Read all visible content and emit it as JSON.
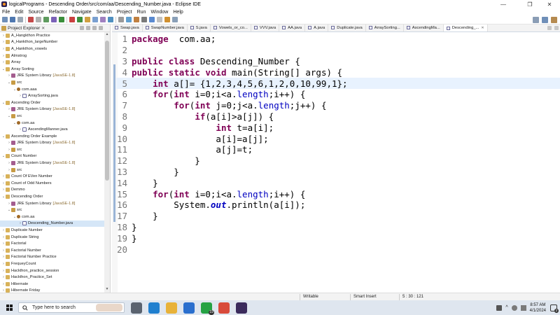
{
  "window": {
    "title": "logicalPrograms - Descending Order/src/com/aa/Descending_Number.java - Eclipse IDE",
    "controls": [
      "—",
      "❐",
      "✕"
    ]
  },
  "menu": [
    "File",
    "Edit",
    "Source",
    "Refactor",
    "Navigate",
    "Search",
    "Project",
    "Run",
    "Window",
    "Help"
  ],
  "toolbar": {
    "colors": [
      "#6f8fb8",
      "#4f78b0",
      "#9aa7b5",
      "#c44848",
      "#b0b0b0",
      "#5e9b5e",
      "#7b62b8",
      "#3a8f3a",
      "#ca4040",
      "#3d8f3d",
      "#d0a040",
      "#7aa0d0",
      "#a080c0",
      "#5090c0",
      "#9a9a9a",
      "#60a0d0",
      "#c08040",
      "#7a7a7a",
      "#5a8ad0",
      "#c0c0c0",
      "#d09030",
      "#8aa0b8"
    ]
  },
  "explorer": {
    "title": "Project Explorer",
    "close": "✕",
    "items": [
      {
        "indent": 0,
        "arrow": "›",
        "icon": "project",
        "label": "A_Hangkthon Practice"
      },
      {
        "indent": 0,
        "arrow": "›",
        "icon": "project",
        "label": "A_Hankthon_largeNumber"
      },
      {
        "indent": 0,
        "arrow": "›",
        "icon": "project",
        "label": "A_Hankthon_vowels"
      },
      {
        "indent": 0,
        "arrow": "›",
        "icon": "project",
        "label": "Almstrog"
      },
      {
        "indent": 0,
        "arrow": "›",
        "icon": "project",
        "label": "Array"
      },
      {
        "indent": 0,
        "arrow": "⌄",
        "icon": "project",
        "label": "Array Sorting"
      },
      {
        "indent": 1,
        "arrow": "›",
        "icon": "library",
        "label": "JRE System Library",
        "jre": "[JavaSE-1.8]"
      },
      {
        "indent": 1,
        "arrow": "⌄",
        "icon": "src",
        "label": "src"
      },
      {
        "indent": 2,
        "arrow": "⌄",
        "icon": "package",
        "label": "com.aaa"
      },
      {
        "indent": 3,
        "arrow": "›",
        "icon": "java",
        "label": "ArraySorting.java"
      },
      {
        "indent": 0,
        "arrow": "⌄",
        "icon": "project",
        "label": "Ascending Order"
      },
      {
        "indent": 1,
        "arrow": "›",
        "icon": "library",
        "label": "JRE System Library",
        "jre": "[JavaSE-1.8]"
      },
      {
        "indent": 1,
        "arrow": "⌄",
        "icon": "src",
        "label": "src"
      },
      {
        "indent": 2,
        "arrow": "⌄",
        "icon": "package",
        "label": "com.aa"
      },
      {
        "indent": 3,
        "arrow": "›",
        "icon": "java",
        "label": "AscendingManner.java"
      },
      {
        "indent": 0,
        "arrow": "⌄",
        "icon": "project",
        "label": "Ascending Order Example"
      },
      {
        "indent": 1,
        "arrow": "›",
        "icon": "library",
        "label": "JRE System Library",
        "jre": "[JavaSE-1.8]"
      },
      {
        "indent": 1,
        "arrow": "›",
        "icon": "src",
        "label": "src"
      },
      {
        "indent": 0,
        "arrow": "⌄",
        "icon": "project",
        "label": "Count Number"
      },
      {
        "indent": 1,
        "arrow": "›",
        "icon": "library",
        "label": "JRE System Library",
        "jre": "[JavaSE-1.8]"
      },
      {
        "indent": 1,
        "arrow": "›",
        "icon": "src",
        "label": "src"
      },
      {
        "indent": 0,
        "arrow": "›",
        "icon": "project",
        "label": "Count Of EVen Number"
      },
      {
        "indent": 0,
        "arrow": "›",
        "icon": "project",
        "label": "Count of Odd Numbers"
      },
      {
        "indent": 0,
        "arrow": "›",
        "icon": "project",
        "label": "Demmo"
      },
      {
        "indent": 0,
        "arrow": "⌄",
        "icon": "project",
        "label": "Descending Order"
      },
      {
        "indent": 1,
        "arrow": "›",
        "icon": "library",
        "label": "JRE System Library",
        "jre": "[JavaSE-1.8]"
      },
      {
        "indent": 1,
        "arrow": "⌄",
        "icon": "src",
        "label": "src"
      },
      {
        "indent": 2,
        "arrow": "⌄",
        "icon": "package",
        "label": "com.aa"
      },
      {
        "indent": 3,
        "arrow": "›",
        "icon": "java",
        "label": "Descending_Number.java",
        "selected": true
      },
      {
        "indent": 0,
        "arrow": "›",
        "icon": "project",
        "label": "Duplicate Number"
      },
      {
        "indent": 0,
        "arrow": "›",
        "icon": "project",
        "label": "Duplicate String"
      },
      {
        "indent": 0,
        "arrow": "›",
        "icon": "project",
        "label": "Factorial"
      },
      {
        "indent": 0,
        "arrow": "›",
        "icon": "project",
        "label": "Factorial Number"
      },
      {
        "indent": 0,
        "arrow": "›",
        "icon": "project",
        "label": "Factorial Number Practice"
      },
      {
        "indent": 0,
        "arrow": "›",
        "icon": "project",
        "label": "FrequeyCount"
      },
      {
        "indent": 0,
        "arrow": "›",
        "icon": "project",
        "label": "Hackthon_practice_session"
      },
      {
        "indent": 0,
        "arrow": "›",
        "icon": "project",
        "label": "Hackthon_Practice_Set"
      },
      {
        "indent": 0,
        "arrow": "›",
        "icon": "project",
        "label": "Hibernate"
      },
      {
        "indent": 0,
        "arrow": "›",
        "icon": "project",
        "label": "Hibernate Friday"
      }
    ]
  },
  "tabs": [
    {
      "label": "Swap.java"
    },
    {
      "label": "SwapNumber.java"
    },
    {
      "label": "S.java"
    },
    {
      "label": "Vowels_or_co..."
    },
    {
      "label": "VVV.java"
    },
    {
      "label": "AA.java"
    },
    {
      "label": "A.java"
    },
    {
      "label": "Duplicate.java"
    },
    {
      "label": "ArraySorting..."
    },
    {
      "label": "AscendingMa..."
    },
    {
      "label": "Descending_...",
      "active": true,
      "close": "✕"
    }
  ],
  "code": {
    "current_line": 5,
    "lines": [
      {
        "n": "1",
        "tokens": [
          [
            "kw",
            "package"
          ],
          [
            "",
            "  com.aa;"
          ]
        ]
      },
      {
        "n": "2",
        "tokens": []
      },
      {
        "n": "3",
        "tokens": [
          [
            "kw",
            "public"
          ],
          [
            "",
            " "
          ],
          [
            "kw",
            "class"
          ],
          [
            "",
            " Descending_Number {"
          ]
        ]
      },
      {
        "n": "4",
        "tokens": [
          [
            "kw",
            "public"
          ],
          [
            "",
            " "
          ],
          [
            "kw",
            "static"
          ],
          [
            "",
            " "
          ],
          [
            "kw",
            "void"
          ],
          [
            "",
            " main(String[] args) {"
          ]
        ]
      },
      {
        "n": "5",
        "tokens": [
          [
            "",
            "    "
          ],
          [
            "kw",
            "int"
          ],
          [
            "",
            " a[]= {1,2,3,4,5,6,1,2,0,10,99,1};"
          ]
        ]
      },
      {
        "n": "6",
        "tokens": [
          [
            "",
            "    "
          ],
          [
            "kw",
            "for"
          ],
          [
            "",
            "("
          ],
          [
            "kw",
            "int"
          ],
          [
            "",
            " i=0;i<a."
          ],
          [
            "fld",
            "length"
          ],
          [
            "",
            ";i++) {"
          ]
        ]
      },
      {
        "n": "7",
        "tokens": [
          [
            "",
            "        "
          ],
          [
            "kw",
            "for"
          ],
          [
            "",
            "("
          ],
          [
            "kw",
            "int"
          ],
          [
            "",
            " j=0;j<a."
          ],
          [
            "fld",
            "length"
          ],
          [
            "",
            ";j++) {"
          ]
        ]
      },
      {
        "n": "8",
        "tokens": [
          [
            "",
            "            "
          ],
          [
            "kw",
            "if"
          ],
          [
            "",
            "(a[i]>a[j]) {"
          ]
        ]
      },
      {
        "n": "9",
        "tokens": [
          [
            "",
            "                "
          ],
          [
            "kw",
            "int"
          ],
          [
            "",
            " t=a[i];"
          ]
        ]
      },
      {
        "n": "10",
        "tokens": [
          [
            "",
            "                a[i]=a[j];"
          ]
        ]
      },
      {
        "n": "11",
        "tokens": [
          [
            "",
            "                a[j]=t;"
          ]
        ]
      },
      {
        "n": "12",
        "tokens": [
          [
            "",
            "            }"
          ]
        ]
      },
      {
        "n": "13",
        "tokens": [
          [
            "",
            "        }"
          ]
        ]
      },
      {
        "n": "14",
        "tokens": [
          [
            "",
            "    }"
          ]
        ]
      },
      {
        "n": "15",
        "tokens": [
          [
            "",
            "    "
          ],
          [
            "kw",
            "for"
          ],
          [
            "",
            "("
          ],
          [
            "kw",
            "int"
          ],
          [
            "",
            " i=0;i<a."
          ],
          [
            "fld",
            "length"
          ],
          [
            "",
            ";i++) {"
          ]
        ]
      },
      {
        "n": "16",
        "tokens": [
          [
            "",
            "        System."
          ],
          [
            "sfld",
            "out"
          ],
          [
            "",
            ".println(a[i]);"
          ]
        ]
      },
      {
        "n": "17",
        "tokens": [
          [
            "",
            "    }"
          ]
        ]
      },
      {
        "n": "18",
        "tokens": [
          [
            "",
            "}"
          ]
        ]
      },
      {
        "n": "19",
        "tokens": [
          [
            "",
            "}"
          ]
        ]
      },
      {
        "n": "20",
        "tokens": []
      }
    ]
  },
  "status": {
    "mode": "Writable",
    "insert": "Smart Insert",
    "position": "5 : 30 : 121"
  },
  "taskbar": {
    "search_placeholder": "Type here to search",
    "apps": [
      {
        "name": "task-view",
        "color": "#5a6370"
      },
      {
        "name": "edge",
        "color": "#1f7fcf"
      },
      {
        "name": "file-explorer",
        "color": "#e8b23a"
      },
      {
        "name": "mail",
        "color": "#2a6fce"
      },
      {
        "name": "whatsapp",
        "color": "#25a244",
        "badge": "19"
      },
      {
        "name": "chrome",
        "color": "#d84a3b"
      },
      {
        "name": "eclipse",
        "color": "#3b2b5c"
      }
    ],
    "time": "8:57 AM",
    "date": "4/1/2024",
    "notifications": "2"
  }
}
